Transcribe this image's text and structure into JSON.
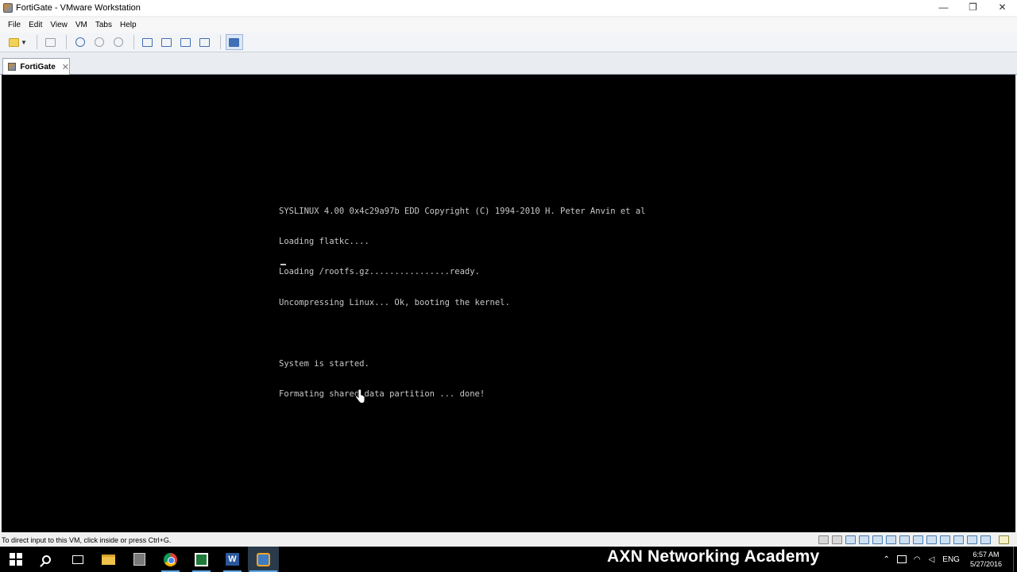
{
  "window": {
    "title": "FortiGate - VMware Workstation",
    "controls": {
      "minimize": "—",
      "restore": "❐",
      "close": "✕"
    }
  },
  "menu": {
    "items": [
      "File",
      "Edit",
      "View",
      "VM",
      "Tabs",
      "Help"
    ]
  },
  "toolbar": {
    "buttons": [
      "power-icon",
      "send-ctrl-alt-del-icon",
      "snapshot-icon",
      "revert-snapshot-icon",
      "snapshot-manager-icon",
      "show-library-icon",
      "thumbnail-bar-icon",
      "full-screen-icon",
      "unity-icon",
      "console-view-icon"
    ]
  },
  "tabs": [
    {
      "label": "FortiGate",
      "close": "✕"
    }
  ],
  "console": {
    "lines": [
      "SYSLINUX 4.00 0x4c29a97b EDD Copyright (C) 1994-2010 H. Peter Anvin et al",
      "Loading flatkc....",
      "Loading /rootfs.gz................ready.",
      "Uncompressing Linux... Ok, booting the kernel.",
      "",
      "System is started.",
      "Formating shared data partition ... done!"
    ]
  },
  "status": {
    "message": "To direct input to this VM, click inside or press Ctrl+G."
  },
  "taskbar": {
    "apps": [
      "start-icon",
      "search-icon",
      "task-view-icon",
      "file-explorer-icon",
      "calculator-icon",
      "chrome-icon",
      "camtasia-icon",
      "word-icon",
      "vmware-icon"
    ],
    "watermark": "AXN Networking Academy",
    "tray": {
      "language": "ENG",
      "time": "6:57 AM",
      "date": "5/27/2016"
    }
  },
  "colors": {
    "console_bg": "#000000",
    "console_fg": "#c8c8c8",
    "accent": "#3f6fb5",
    "taskbar_bg": "#000000"
  }
}
